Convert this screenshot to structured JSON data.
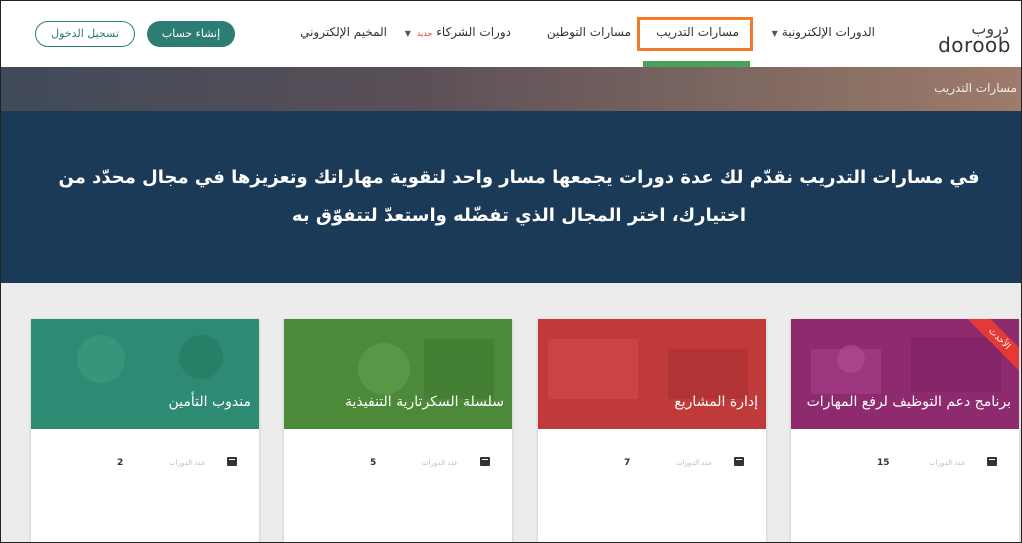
{
  "header": {
    "logo_ar": "دروب",
    "logo_en": "doroob",
    "nav": {
      "e_courses": "الدورات الإلكترونية",
      "training_paths": "مسارات التدريب",
      "localization_paths": "مسارات التوطين",
      "partner_courses": "دورات الشركاء",
      "partner_badge": "جديد",
      "e_camp": "المخيم الإلكتروني"
    },
    "create_account": "إنشاء حساب",
    "login": "تسجيل الدخول"
  },
  "breadcrumb": "مسارات التدريب",
  "hero": {
    "text": "في مسارات التدريب نقدّم لك عدة دورات يجمعها مسار واحد لتقوية مهاراتك وتعزيزها في مجال محدّد من اختيارك، اختر المجال الذي تفضّله واستعدّ لتتفوّق به"
  },
  "cards": [
    {
      "title": "برنامج دعم التوظيف لرفع المهارات",
      "count": "15",
      "meta_label": "عدد الدورات",
      "ribbon": "الأحدث",
      "color": "#8e2a6e"
    },
    {
      "title": "إدارة المشاريع",
      "count": "7",
      "meta_label": "عدد الدورات",
      "color": "#c03a3a"
    },
    {
      "title": "سلسلة السكرتارية التنفيذية",
      "count": "5",
      "meta_label": "عدد الدورات",
      "color": "#4c8a3a"
    },
    {
      "title": "مندوب التأمين",
      "count": "2",
      "meta_label": "عدد الدورات",
      "color": "#2e8a72"
    }
  ],
  "colors": {
    "accent": "#2e7d74",
    "hero": "#1b3a57",
    "highlight": "#f07a2a",
    "active_bar": "#45a35a"
  }
}
